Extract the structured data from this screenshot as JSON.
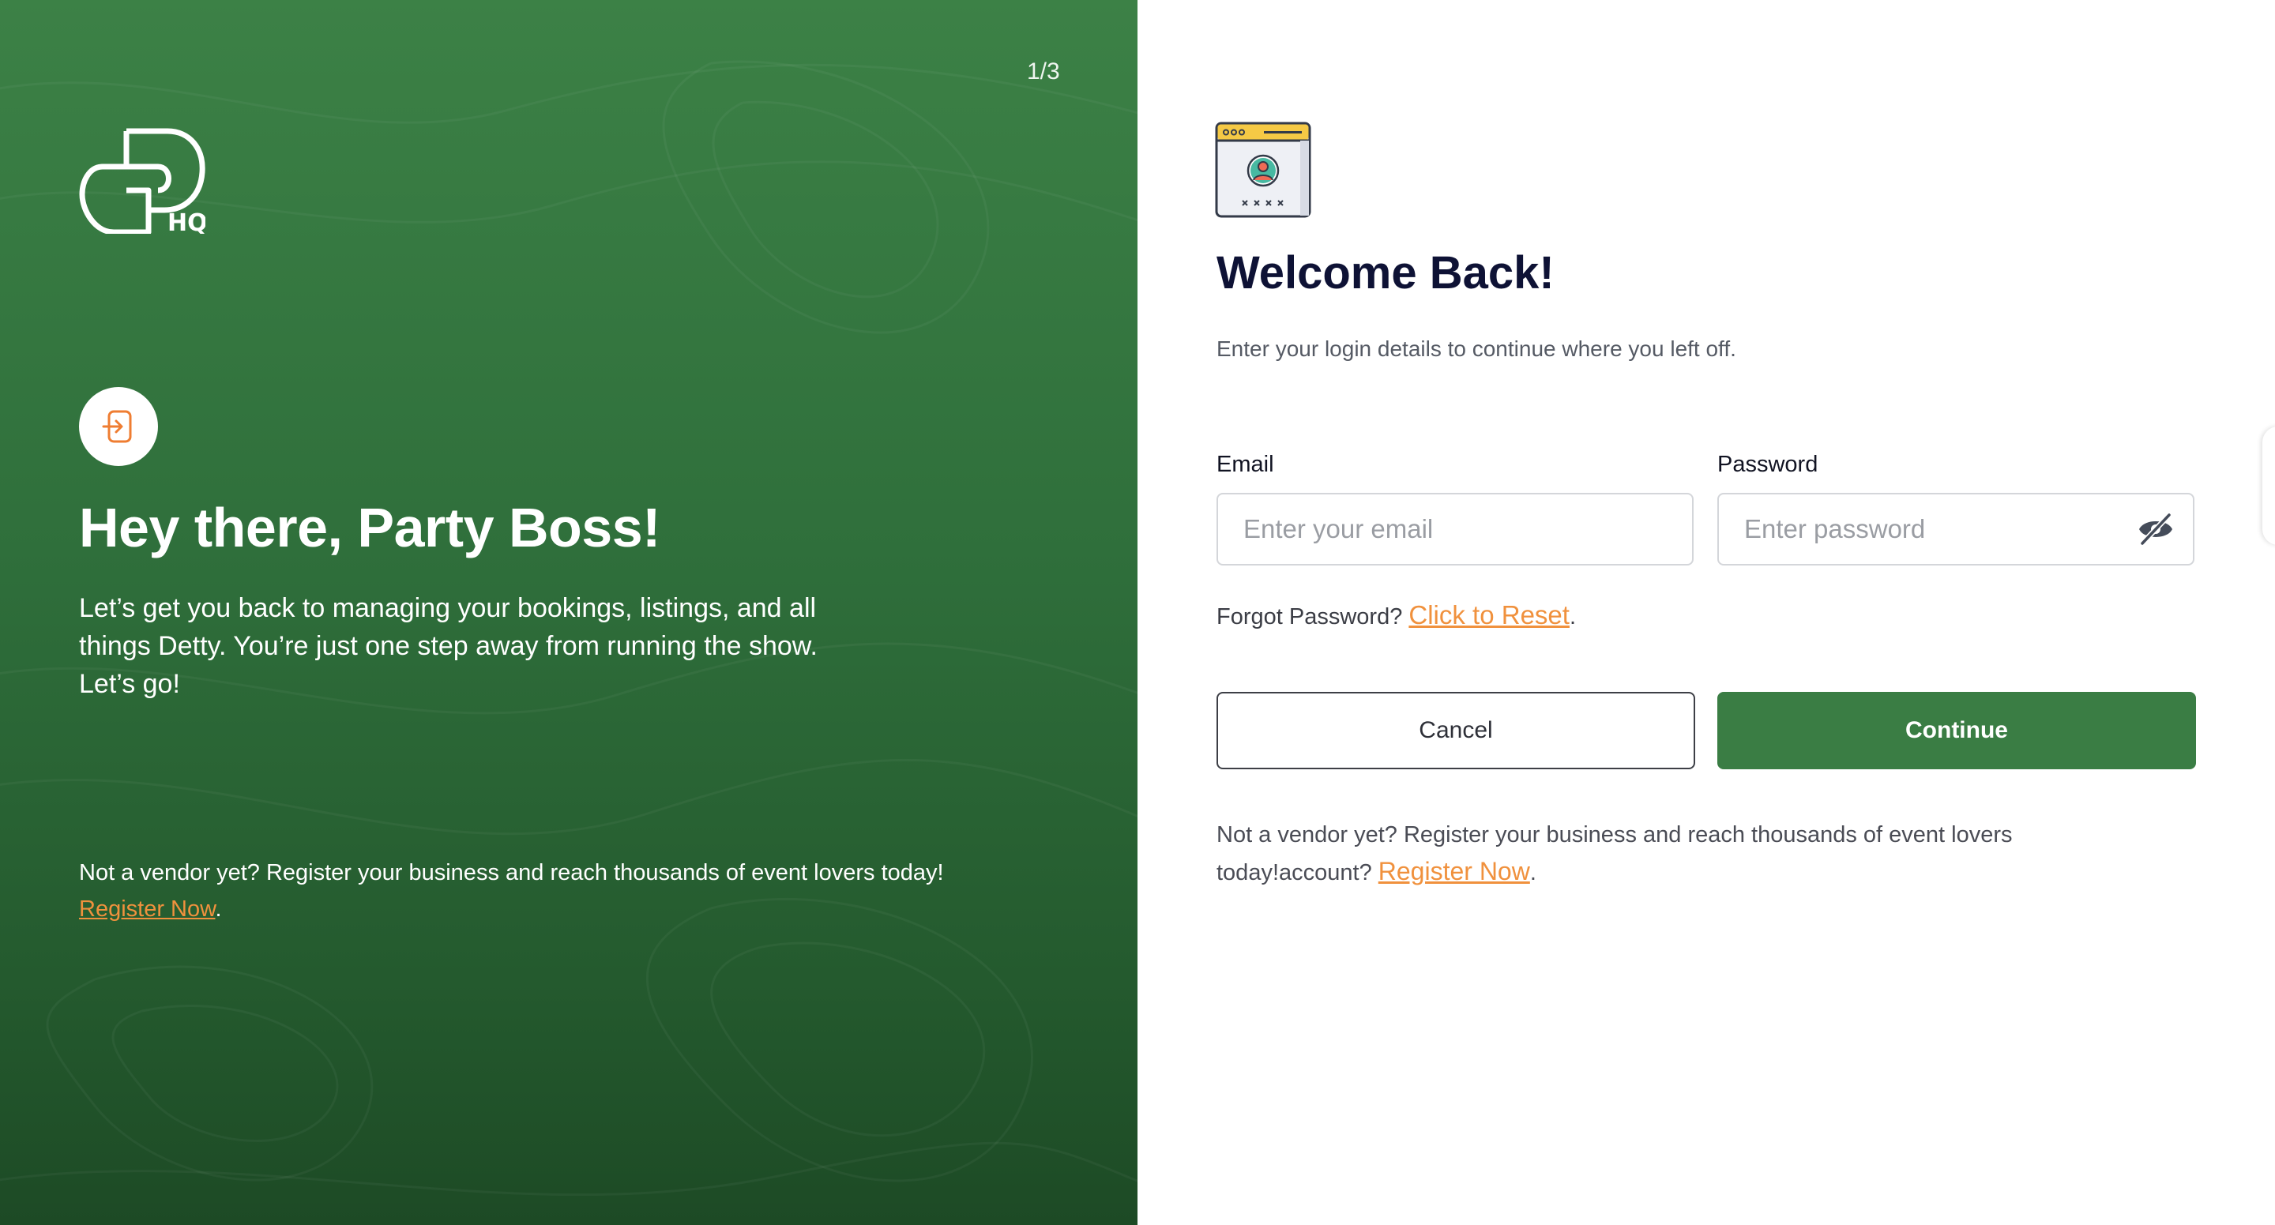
{
  "left_panel": {
    "step_indicator": "1/3",
    "logo_text": "HQ",
    "hero_title": "Hey there, Party Boss!",
    "hero_text": "Let’s get you back to managing your bookings, listings, and all things Detty. You’re just one step away from running the show. Let’s go!",
    "footer_text": "Not a vendor yet? Register your business and reach thousands of event lovers today! ",
    "footer_link": "Register Now",
    "footer_end": "."
  },
  "right_panel": {
    "title": "Welcome Back!",
    "subtitle": "Enter your login details to continue where you left off.",
    "email": {
      "label": "Email",
      "placeholder": "Enter your email",
      "value": ""
    },
    "password": {
      "label": "Password",
      "placeholder": "Enter password",
      "value": ""
    },
    "forgot_text": "Forgot Password? ",
    "forgot_link": "Click to Reset",
    "forgot_end": ".",
    "cancel_label": "Cancel",
    "continue_label": "Continue",
    "footer_text": "Not a vendor yet? Register your business and reach thousands of event lovers today!account? ",
    "footer_link": "Register Now",
    "footer_end": "."
  },
  "icons": {
    "logo": "brand-logo-icon",
    "login_badge": "login-arrow-icon",
    "illustration": "browser-login-icon",
    "password_toggle": "eye-off-icon"
  },
  "colors": {
    "panel_green": "#2f6f3b",
    "accent_orange": "#f0913d",
    "primary_button": "#3a7d44",
    "title_navy": "#0e1235"
  }
}
